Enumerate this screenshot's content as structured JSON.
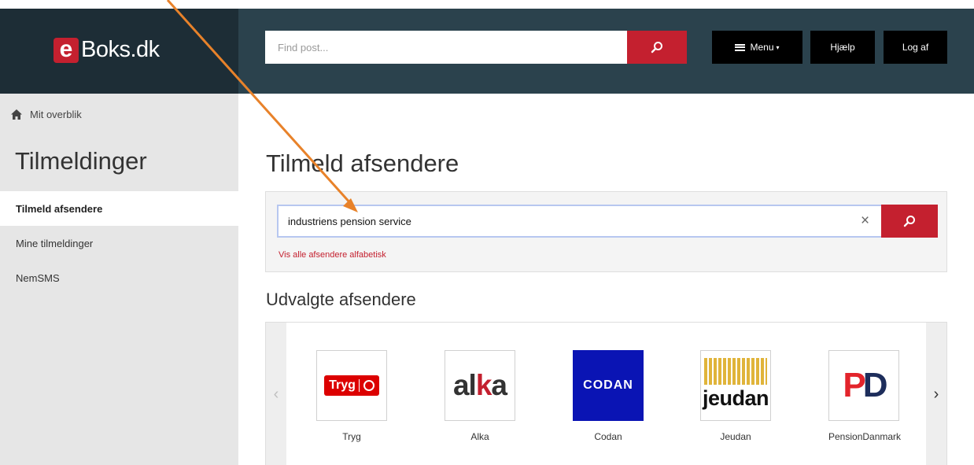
{
  "header": {
    "logo_letter": "e",
    "logo_text": "Boks.dk",
    "search_placeholder": "Find post...",
    "menu_label": "Menu",
    "menu_caret": "▾",
    "help_label": "Hjælp",
    "logout_label": "Log af"
  },
  "sidebar": {
    "home_label": "Mit overblik",
    "title": "Tilmeldinger",
    "items": [
      {
        "label": "Tilmeld afsendere",
        "active": true
      },
      {
        "label": "Mine tilmeldinger",
        "active": false
      },
      {
        "label": "NemSMS",
        "active": false
      }
    ]
  },
  "main": {
    "title": "Tilmeld afsendere",
    "search_value": "industriens pension service",
    "clear_symbol": "×",
    "alpha_link": "Vis alle afsendere alfabetisk",
    "featured_title": "Udvalgte afsendere",
    "arrow_left": "‹",
    "arrow_right": "›",
    "senders": [
      {
        "name": "Tryg",
        "logo_text": "Tryg"
      },
      {
        "name": "Alka",
        "logo_text_a": "al",
        "logo_text_k": "k",
        "logo_text_b": "a"
      },
      {
        "name": "Codan",
        "logo_text": "CODAN"
      },
      {
        "name": "Jeudan",
        "logo_text": "jeudan"
      },
      {
        "name": "PensionDanmark",
        "logo_p": "P",
        "logo_d": "D"
      }
    ]
  },
  "colors": {
    "brand_red": "#c4202f",
    "header_dark": "#1d2d36",
    "header_bar": "#2b424d",
    "annotation_arrow": "#e8822a"
  }
}
